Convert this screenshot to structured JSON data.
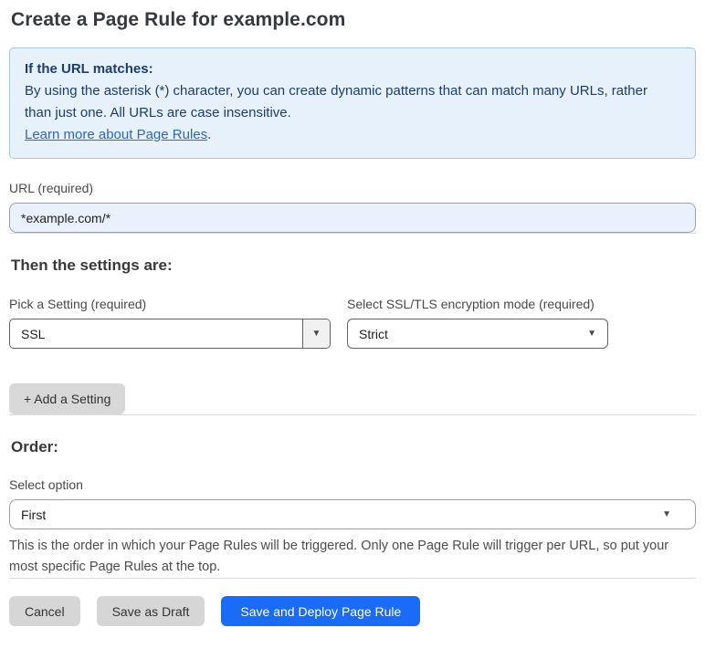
{
  "page": {
    "title": "Create a Page Rule for example.com"
  },
  "info_box": {
    "heading": "If the URL matches:",
    "body": "By using the asterisk (*) character, you can create dynamic patterns that can match many URLs, rather than just one. All URLs are case insensitive.",
    "link_label": "Learn more about Page Rules",
    "link_suffix": "."
  },
  "url_field": {
    "label": "URL (required)",
    "value": "*example.com/*"
  },
  "settings_section": {
    "heading": "Then the settings are:",
    "setting_select": {
      "label": "Pick a Setting (required)",
      "value": "SSL"
    },
    "mode_select": {
      "label": "Select SSL/TLS encryption mode (required)",
      "value": "Strict"
    },
    "add_setting_label": "+ Add a Setting"
  },
  "order_section": {
    "heading": "Order:",
    "select_label": "Select option",
    "select_value": "First",
    "help_text": "This is the order in which your Page Rules will be triggered. Only one Page Rule will trigger per URL, so put your most specific Page Rules at the top."
  },
  "actions": {
    "cancel_label": "Cancel",
    "save_draft_label": "Save as Draft",
    "save_deploy_label": "Save and Deploy Page Rule"
  },
  "icons": {
    "dropdown_arrow": "▼"
  },
  "colors": {
    "accent_blue": "#1a6bf7",
    "info_background": "#e7f1fb",
    "info_border": "#a9c8e8",
    "info_text": "#1c3d6e",
    "link_blue": "#2d66c3",
    "input_background": "#e9f1fc",
    "button_gray": "#d6d6d6"
  }
}
